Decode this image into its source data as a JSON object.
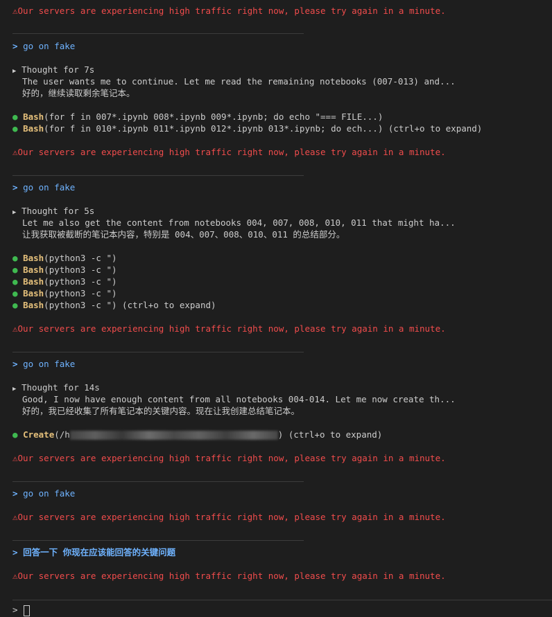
{
  "error_text": "Our servers are experiencing high traffic right now, please try again in a minute.",
  "prompt_prefix": ">",
  "blocks": [
    {
      "user": "go on fake",
      "thought_label": "Thought for 7s",
      "thought_en": "The user wants me to continue. Let me read the remaining notebooks (007-013) and...",
      "thought_zh": "好的，继续读取剩余笔记本。",
      "tools": [
        {
          "name": "Bash",
          "args": "(for f in 007*.ipynb 008*.ipynb 009*.ipynb; do echo \"=== FILE...)",
          "suffix": ""
        },
        {
          "name": "Bash",
          "args": "(for f in 010*.ipynb 011*.ipynb 012*.ipynb 013*.ipynb; do ech...)",
          "suffix": " (ctrl+o to expand)"
        }
      ]
    },
    {
      "user": "go on fake",
      "thought_label": "Thought for 5s",
      "thought_en": "Let me also get the content from notebooks 004, 007, 008, 010, 011 that might ha...",
      "thought_zh": "让我获取被截断的笔记本内容，特别是 004、007、008、010、011 的总结部分。",
      "tools": [
        {
          "name": "Bash",
          "args": "(python3 -c \")",
          "suffix": ""
        },
        {
          "name": "Bash",
          "args": "(python3 -c \")",
          "suffix": ""
        },
        {
          "name": "Bash",
          "args": "(python3 -c \")",
          "suffix": ""
        },
        {
          "name": "Bash",
          "args": "(python3 -c \")",
          "suffix": ""
        },
        {
          "name": "Bash",
          "args": "(python3 -c \")",
          "suffix": " (ctrl+o to expand)"
        }
      ]
    },
    {
      "user": "go on fake",
      "thought_label": "Thought for 14s",
      "thought_en": "Good, I now have enough content from all notebooks 004-014. Let me now create th...",
      "thought_zh": "好的，我已经收集了所有笔记本的关键内容。现在让我创建总结笔记本。",
      "tools": [
        {
          "name": "Create",
          "args_prefix": "(/h",
          "args_suffix": ")",
          "suffix": " (ctrl+o to expand)"
        }
      ]
    },
    {
      "user": "go on fake"
    },
    {
      "user": "回答一下 你现在应该能回答的关键问题"
    }
  ],
  "input": {
    "prompt": ">",
    "value": ""
  }
}
